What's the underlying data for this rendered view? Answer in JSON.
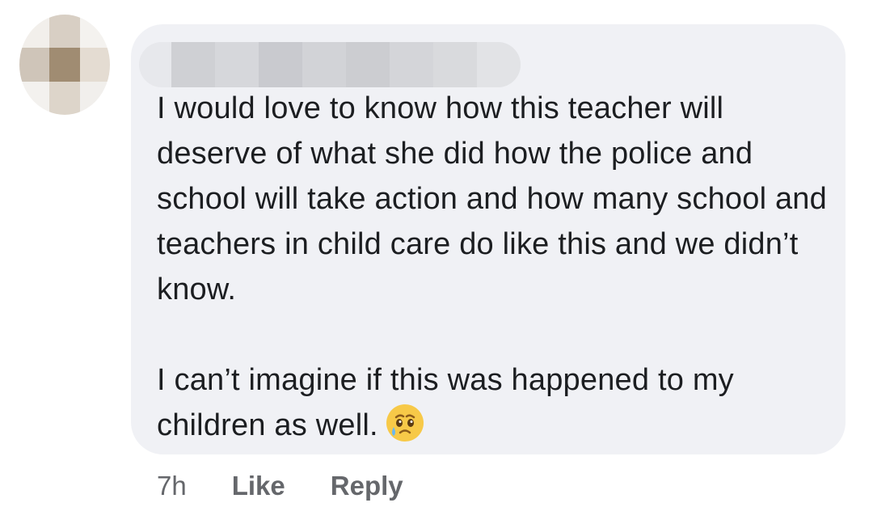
{
  "comment": {
    "author_name": "",
    "paragraph_1": "I would love to know how this teacher will deserve of what she did how the police and school will take action and how many school and teachers in child care do like this and we didn’t know.",
    "paragraph_2": "I can’t imagine if this was happened to my children as well.",
    "emoji": "face-holding-back-tears-icon"
  },
  "actions": {
    "timestamp": "7h",
    "like_label": "Like",
    "reply_label": "Reply"
  },
  "colors": {
    "bubble_bg": "#f0f1f5",
    "text": "#1c1e21",
    "action_text": "#65676b",
    "emoji_face": "#f7c948",
    "tear": "#6bb7f0"
  }
}
